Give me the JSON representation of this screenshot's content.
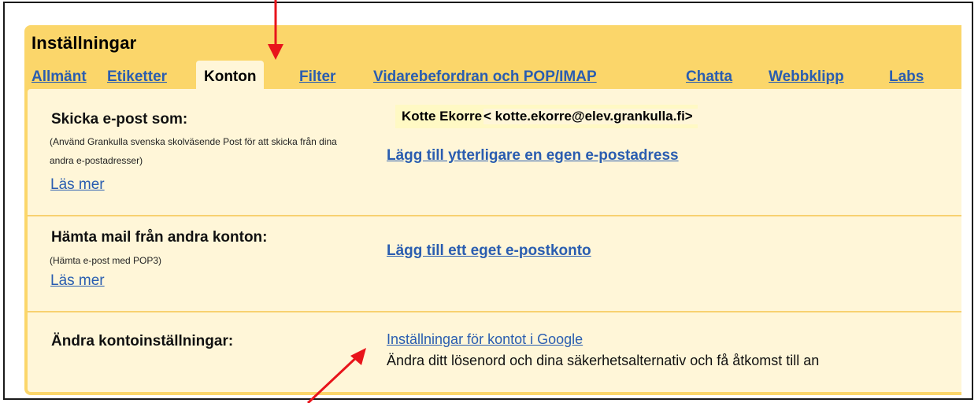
{
  "settings": {
    "title": "Inställningar",
    "tabs": [
      {
        "label": "Allmänt",
        "active": false
      },
      {
        "label": "Etiketter",
        "active": false
      },
      {
        "label": "Konton",
        "active": true
      },
      {
        "label": "Filter",
        "active": false
      },
      {
        "label": "Vidarebefordran och POP/IMAP",
        "active": false
      },
      {
        "label": "Chatta",
        "active": false
      },
      {
        "label": "Webbklipp",
        "active": false
      },
      {
        "label": "Labs",
        "active": false
      }
    ],
    "send_as": {
      "label": "Skicka e-post som:",
      "hint": "(Använd Grankulla svenska skolväsende Post för att skicka från dina andra e-postadresser)",
      "more": "Läs mer",
      "name": "Kotte Ekorre",
      "email": "< kotte.ekorre@elev.grankulla.fi>",
      "add_link": "Lägg till ytterligare en egen e-postadress"
    },
    "fetch": {
      "label": "Hämta mail från andra konton:",
      "hint": "(Hämta e-post med POP3)",
      "more": "Läs mer",
      "add_link": "Lägg till ett eget e-postkonto"
    },
    "change": {
      "label": "Ändra kontoinställningar:",
      "link": "Inställningar för kontot i Google",
      "desc": "Ändra ditt lösenord och dina säkerhetsalternativ och få åtkomst till an"
    }
  },
  "colors": {
    "panel": "#fbd66a",
    "content": "#fff6d8",
    "link": "#2a5db0",
    "arrow": "#e8141b"
  }
}
